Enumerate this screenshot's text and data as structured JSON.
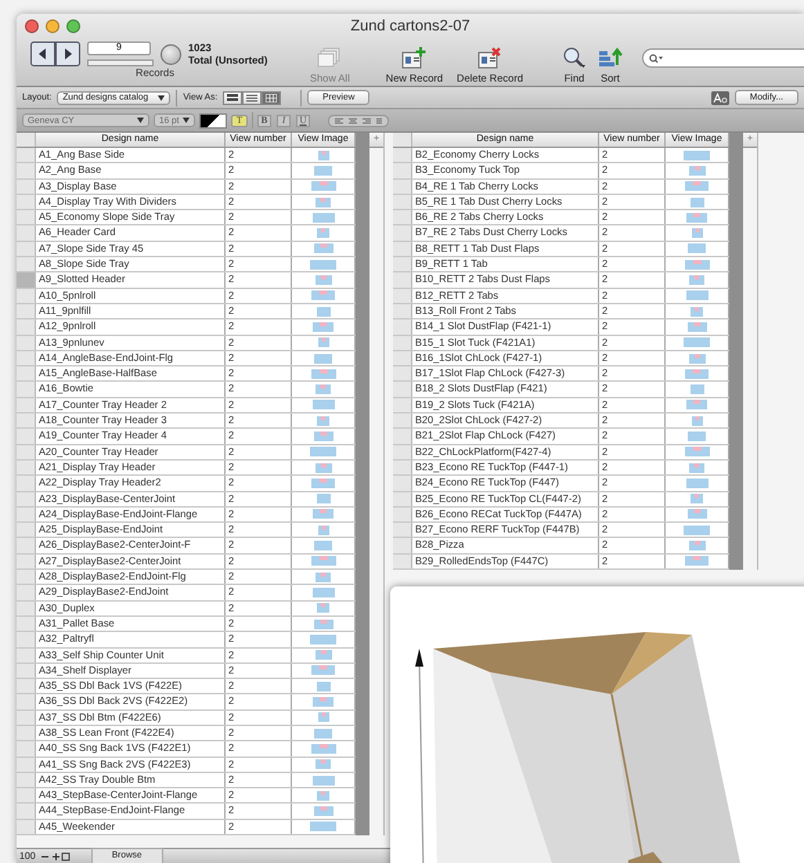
{
  "window": {
    "title": "Zund cartons2-07"
  },
  "toolbar": {
    "record_field": "9",
    "record_count": "1023",
    "record_status": "Total (Unsorted)",
    "records_label": "Records",
    "buttons": [
      {
        "kind": "showall",
        "label": "Show All",
        "disabled": true
      },
      {
        "kind": "new",
        "label": "New Record",
        "disabled": false
      },
      {
        "kind": "delete",
        "label": "Delete Record",
        "disabled": false
      },
      {
        "kind": "find",
        "label": "Find",
        "disabled": false
      },
      {
        "kind": "sort",
        "label": "Sort",
        "disabled": false
      }
    ]
  },
  "layout_bar": {
    "layout_label": "Layout:",
    "layout_value": "Zund designs catalog",
    "view_as_label": "View As:",
    "view_modes": [
      {
        "kind": "form",
        "selected": false
      },
      {
        "kind": "list",
        "selected": false
      },
      {
        "kind": "table",
        "selected": true
      }
    ],
    "preview": "Preview",
    "modify": "Modify..."
  },
  "format_bar": {
    "disabled": true,
    "font": "Geneva CY",
    "size": "16 pt",
    "highlight": "T",
    "styles": [
      "B",
      "I",
      "U"
    ]
  },
  "tables": [
    {
      "columns": [
        "Design name",
        "View number",
        "View Image"
      ],
      "add_column": "+",
      "rows": [
        {
          "name": "A1_Ang Base Side",
          "number": "2",
          "selected": false
        },
        {
          "name": "A2_Ang Base",
          "number": "2",
          "selected": false
        },
        {
          "name": "A3_Display Base",
          "number": "2",
          "selected": false
        },
        {
          "name": "A4_Display Tray With Dividers",
          "number": "2",
          "selected": false
        },
        {
          "name": "A5_Economy Slope Side Tray",
          "number": "2",
          "selected": false
        },
        {
          "name": "A6_Header Card",
          "number": "2",
          "selected": false
        },
        {
          "name": "A7_Slope Side Tray  45",
          "number": "2",
          "selected": false
        },
        {
          "name": "A8_Slope Side Tray",
          "number": "2",
          "selected": false
        },
        {
          "name": "A9_Slotted Header",
          "number": "2",
          "selected": true
        },
        {
          "name": "A10_5pnlroll",
          "number": "2",
          "selected": false
        },
        {
          "name": "A11_9pnlfill",
          "number": "2",
          "selected": false
        },
        {
          "name": "A12_9pnlroll",
          "number": "2",
          "selected": false
        },
        {
          "name": "A13_9pnlunev",
          "number": "2",
          "selected": false
        },
        {
          "name": "A14_AngleBase-EndJoint-Flg",
          "number": "2",
          "selected": false
        },
        {
          "name": "A15_AngleBase-HalfBase",
          "number": "2",
          "selected": false
        },
        {
          "name": "A16_Bowtie",
          "number": "2",
          "selected": false
        },
        {
          "name": "A17_Counter Tray Header 2",
          "number": "2",
          "selected": false
        },
        {
          "name": "A18_Counter Tray Header 3",
          "number": "2",
          "selected": false
        },
        {
          "name": "A19_Counter Tray Header 4",
          "number": "2",
          "selected": false
        },
        {
          "name": "A20_Counter Tray Header",
          "number": "2",
          "selected": false
        },
        {
          "name": "A21_Display Tray Header",
          "number": "2",
          "selected": false
        },
        {
          "name": "A22_Display Tray Header2",
          "number": "2",
          "selected": false
        },
        {
          "name": "A23_DisplayBase-CenterJoint",
          "number": "2",
          "selected": false
        },
        {
          "name": "A24_DisplayBase-EndJoint-Flange",
          "number": "2",
          "selected": false
        },
        {
          "name": "A25_DisplayBase-EndJoint",
          "number": "2",
          "selected": false
        },
        {
          "name": "A26_DisplayBase2-CenterJoint-F",
          "number": "2",
          "selected": false
        },
        {
          "name": "A27_DisplayBase2-CenterJoint",
          "number": "2",
          "selected": false
        },
        {
          "name": "A28_DisplayBase2-EndJoint-Flg",
          "number": "2",
          "selected": false
        },
        {
          "name": "A29_DisplayBase2-EndJoint",
          "number": "2",
          "selected": false
        },
        {
          "name": "A30_Duplex",
          "number": "2",
          "selected": false
        },
        {
          "name": "A31_Pallet Base",
          "number": "2",
          "selected": false
        },
        {
          "name": "A32_Paltryfl",
          "number": "2",
          "selected": false
        },
        {
          "name": "A33_Self Ship Counter Unit",
          "number": "2",
          "selected": false
        },
        {
          "name": "A34_Shelf Displayer",
          "number": "2",
          "selected": false
        },
        {
          "name": "A35_SS Dbl Back 1VS (F422E)",
          "number": "2",
          "selected": false
        },
        {
          "name": "A36_SS Dbl Back 2VS (F422E2)",
          "number": "2",
          "selected": false
        },
        {
          "name": "A37_SS Dbl Btm (F422E6)",
          "number": "2",
          "selected": false
        },
        {
          "name": "A38_SS Lean Front (F422E4)",
          "number": "2",
          "selected": false
        },
        {
          "name": "A40_SS Sng Back 1VS (F422E1)",
          "number": "2",
          "selected": false
        },
        {
          "name": "A41_SS Sng Back 2VS (F422E3)",
          "number": "2",
          "selected": false
        },
        {
          "name": "A42_SS Tray Double Btm",
          "number": "2",
          "selected": false
        },
        {
          "name": "A43_StepBase-CenterJoint-Flange",
          "number": "2",
          "selected": false
        },
        {
          "name": "A44_StepBase-EndJoint-Flange",
          "number": "2",
          "selected": false
        },
        {
          "name": "A45_Weekender",
          "number": "2",
          "selected": false
        }
      ]
    },
    {
      "columns": [
        "Design name",
        "View number",
        "View Image"
      ],
      "add_column": "+",
      "rows": [
        {
          "name": "B2_Economy Cherry Locks",
          "number": "2",
          "selected": false
        },
        {
          "name": "B3_Economy Tuck Top",
          "number": "2",
          "selected": false
        },
        {
          "name": "B4_RE 1 Tab Cherry Locks",
          "number": "2",
          "selected": false
        },
        {
          "name": "B5_RE 1 Tab Dust Cherry Locks",
          "number": "2",
          "selected": false
        },
        {
          "name": "B6_RE 2 Tabs Cherry Locks",
          "number": "2",
          "selected": false
        },
        {
          "name": "B7_RE 2 Tabs Dust Cherry Locks",
          "number": "2",
          "selected": false
        },
        {
          "name": "B8_RETT 1 Tab Dust Flaps",
          "number": "2",
          "selected": false
        },
        {
          "name": "B9_RETT 1 Tab",
          "number": "2",
          "selected": false
        },
        {
          "name": "B10_RETT 2 Tabs Dust Flaps",
          "number": "2",
          "selected": false
        },
        {
          "name": "B12_RETT 2 Tabs",
          "number": "2",
          "selected": false
        },
        {
          "name": "B13_Roll Front 2 Tabs",
          "number": "2",
          "selected": false
        },
        {
          "name": "B14_1 Slot DustFlap (F421-1)",
          "number": "2",
          "selected": false
        },
        {
          "name": "B15_1 Slot Tuck (F421A1)",
          "number": "2",
          "selected": false
        },
        {
          "name": "B16_1Slot ChLock (F427-1)",
          "number": "2",
          "selected": false
        },
        {
          "name": "B17_1Slot Flap ChLock (F427-3)",
          "number": "2",
          "selected": false
        },
        {
          "name": "B18_2 Slots DustFlap (F421)",
          "number": "2",
          "selected": false
        },
        {
          "name": "B19_2 Slots Tuck (F421A)",
          "number": "2",
          "selected": false
        },
        {
          "name": "B20_2Slot ChLock (F427-2)",
          "number": "2",
          "selected": false
        },
        {
          "name": "B21_2Slot Flap ChLock (F427)",
          "number": "2",
          "selected": false
        },
        {
          "name": "B22_ChLockPlatform(F427-4)",
          "number": "2",
          "selected": false
        },
        {
          "name": "B23_Econo RE TuckTop (F447-1)",
          "number": "2",
          "selected": false
        },
        {
          "name": "B24_Econo RE TuckTop (F447)",
          "number": "2",
          "selected": false
        },
        {
          "name": "B25_Econo RE TuckTop CL(F447-2)",
          "number": "2",
          "selected": false
        },
        {
          "name": "B26_Econo RECat TuckTop (F447A)",
          "number": "2",
          "selected": false
        },
        {
          "name": "B27_Econo RERF TuckTop (F447B)",
          "number": "2",
          "selected": false
        },
        {
          "name": "B28_Pizza",
          "number": "2",
          "selected": false
        },
        {
          "name": "B29_RolledEndsTop (F447C)",
          "number": "2",
          "selected": false
        }
      ]
    }
  ],
  "status_bar": {
    "zoom": "100",
    "mode": "Browse"
  }
}
